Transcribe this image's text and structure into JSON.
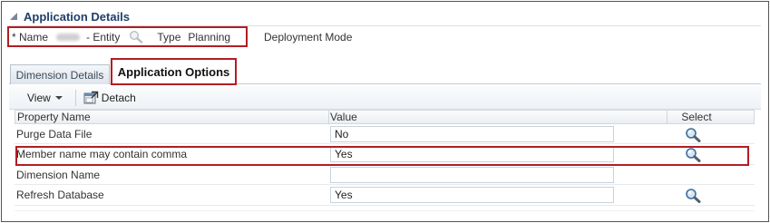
{
  "panel": {
    "title": "Application Details",
    "name_label": "* Name",
    "entity_suffix": "- Entity",
    "type_label": "Type",
    "type_value": "Planning",
    "deployment_label": "Deployment Mode"
  },
  "tabs": [
    {
      "label": "Dimension Details",
      "selected": false
    },
    {
      "label": "Application Options",
      "selected": true
    }
  ],
  "toolbar": {
    "view_label": "View",
    "detach_label": "Detach"
  },
  "grid": {
    "columns": [
      "Property Name",
      "Value",
      "Select"
    ],
    "rows": [
      {
        "property": "Purge Data File",
        "value": "No",
        "has_select": true
      },
      {
        "property": "Member name may contain comma",
        "value": "Yes",
        "has_select": true,
        "highlighted": true
      },
      {
        "property": "Dimension Name",
        "value": "",
        "has_select": false
      },
      {
        "property": "Refresh Database",
        "value": "Yes",
        "has_select": true
      }
    ]
  },
  "icons": {
    "collapse": "collapse-triangle-icon",
    "search": "magnifier-icon",
    "detach": "detach-icon"
  },
  "colors": {
    "highlight_border": "#b01e24",
    "title_text": "#1f3e6b"
  }
}
